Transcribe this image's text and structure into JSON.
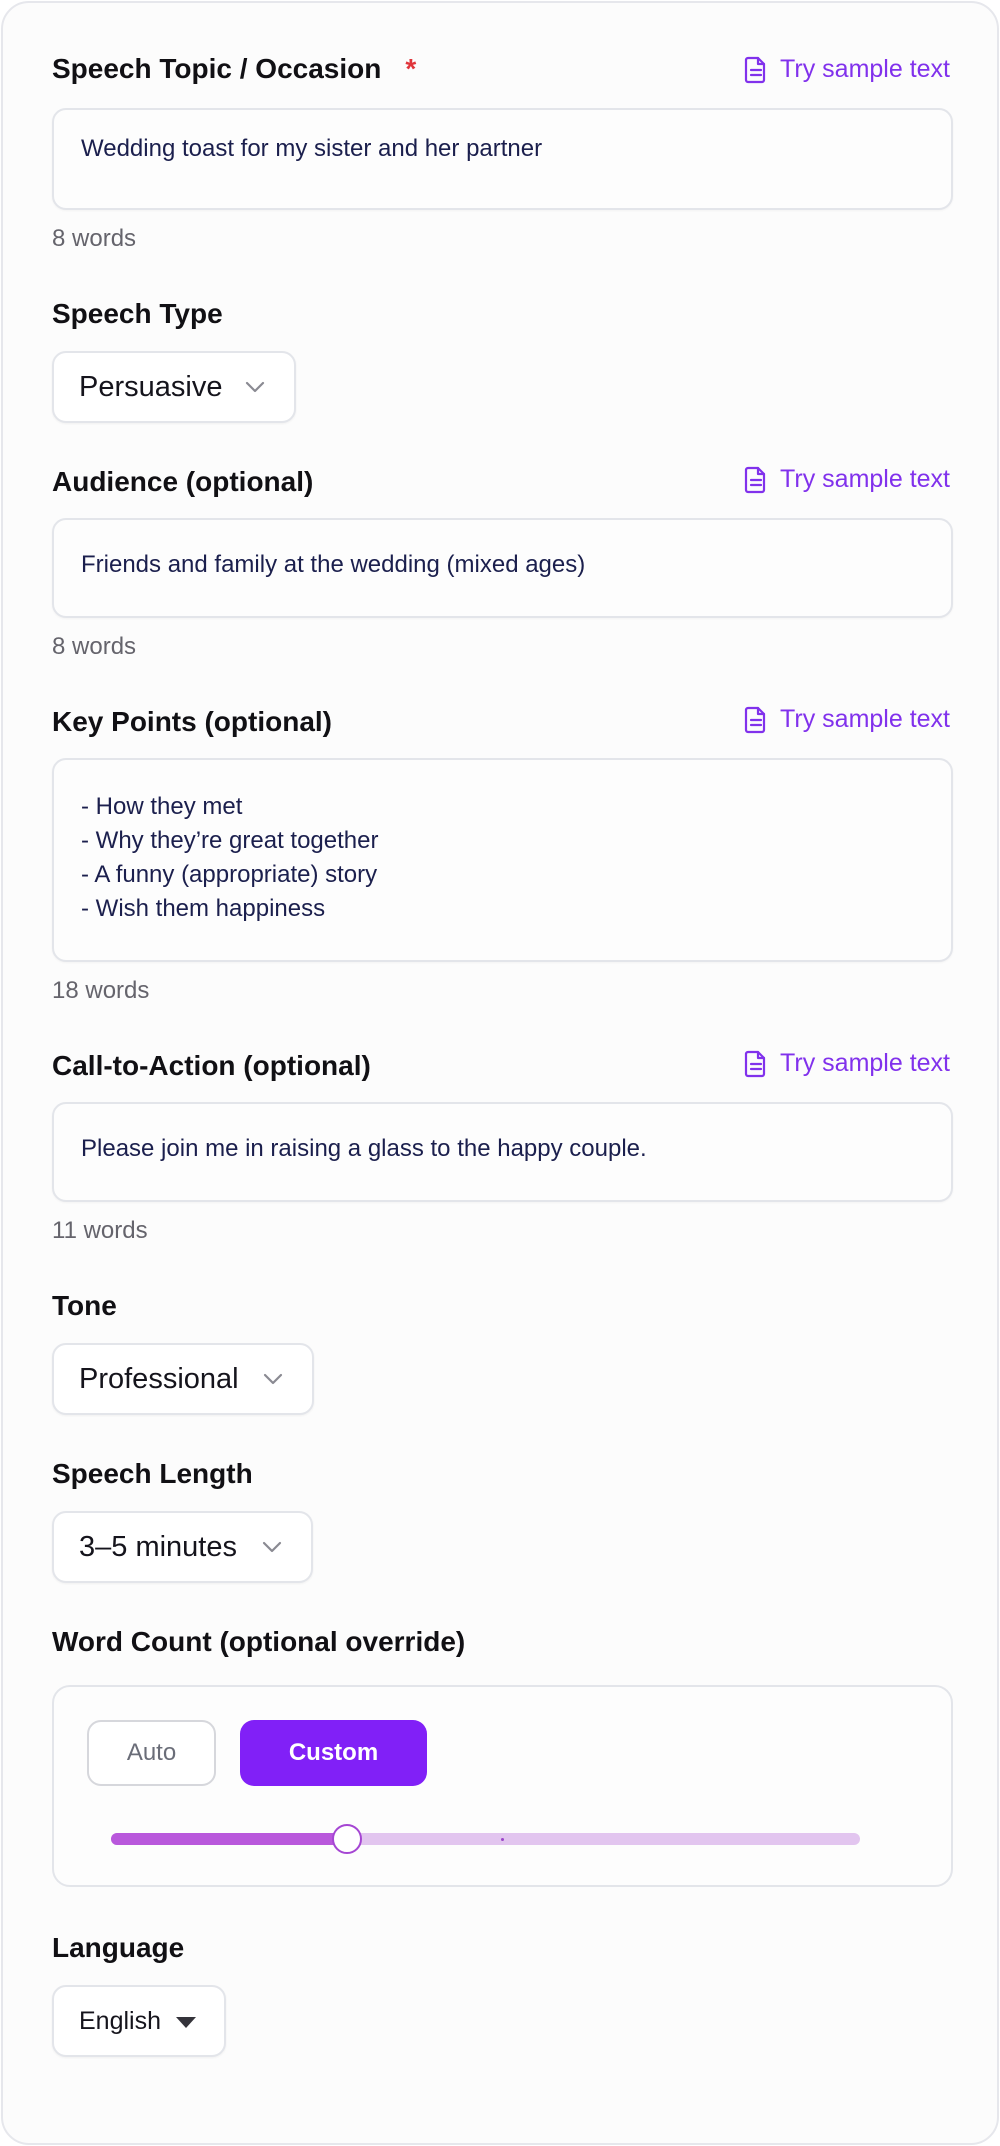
{
  "colors": {
    "accent": "#8120f7",
    "link": "#8131ec",
    "required": "#e0353b",
    "slider_fill": "#b958dc",
    "slider_track": "#e2c5ef"
  },
  "sample_link_label": "Try sample text",
  "sample_link_icon": "document-icon",
  "topic": {
    "label": "Speech Topic / Occasion",
    "required_mark": "*",
    "value": "Wedding toast for my sister and her partner",
    "word_count": "8 words"
  },
  "speech_type": {
    "label": "Speech Type",
    "selected": "Persuasive"
  },
  "audience": {
    "label": "Audience (optional)",
    "value": "Friends and family at the wedding (mixed ages)",
    "word_count": "8 words"
  },
  "key_points": {
    "label": "Key Points (optional)",
    "value": "- How they met\n- Why they’re great together\n- A funny (appropriate) story\n- Wish them happiness",
    "word_count": "18 words"
  },
  "cta": {
    "label": "Call-to-Action (optional)",
    "value": "Please join me in raising a glass to the happy couple.",
    "word_count": "11 words"
  },
  "tone": {
    "label": "Tone",
    "selected": "Professional"
  },
  "speech_length": {
    "label": "Speech Length",
    "selected": "3–5 minutes"
  },
  "word_count_override": {
    "label": "Word Count (optional override)",
    "auto_label": "Auto",
    "custom_label": "Custom",
    "active_mode": "Custom",
    "slider_fraction": 0.315
  },
  "language": {
    "label": "Language",
    "selected": "English"
  }
}
